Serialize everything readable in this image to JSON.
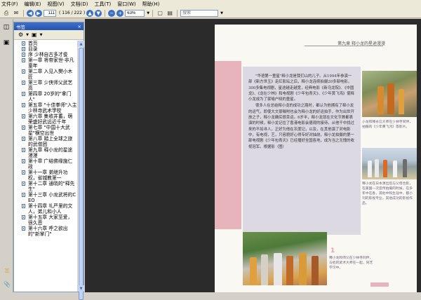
{
  "menubar": {
    "items": [
      "文件(F)",
      "编辑(E)",
      "视图(V)",
      "文档(D)",
      "工具(T)",
      "窗口(W)",
      "帮助(H)"
    ]
  },
  "toolbar": {
    "page_current": "111",
    "page_count": "( 116 / 222 )",
    "zoom": "63%",
    "search_placeholder": "搜索"
  },
  "bookmarks_panel": {
    "title": "书签",
    "close": "×",
    "items": [
      "首页",
      "目录",
      "序 少林自古多才俊",
      "第一章 将帝家世·非凡童年",
      "第二章 入见入樊小木匠",
      "第三章 少侠师父武艺高",
      "第四章 20岁的\"拿门人\"",
      "第五章 \"十佳拳师\"入主少林寺武术学校",
      "第六章 集收并蓄，萌荣盛好武远近千年",
      "第七章 \"中国十大武星\"横空出世",
      "第八章 踏上全球之旅的武僧团",
      "第九章 释小龙的星途漫漫",
      "第十章 广结佛缘施仁政",
      "第十一章 弟继升功权，省城教第一",
      "第十二章 通晓的\"释先生\"",
      "第十三章 小龙武将的CEO",
      "第十四章 礼严里的文人，弟儿和小人",
      "第十五章 大家至爱，很久恩",
      "第十六章 呼之欲出的\"新掌门\""
    ]
  },
  "page": {
    "chapter_header": "第九章  释小龙的星途漫漫",
    "paragraphs": [
      "\"华语第一童星\"释小龙是我们山的儿子。从1994年参演一部《新方世玉》走红影坛之后，释小龙连续拍摄20多部电影，300多集电视剧，星途越走越宽，经典电影《新乌龙院》、《中国龙》、《龙在少林》和电视剧《少年包青天》、《少年黄飞鸿》使释小龙成为了家喻户晓的童星。",
      "很多人在总结释小龙的成功之路时，都认为他拥有了释小龙的运气，即使大文豪嘱咐也会为释小龙的好运拍手，作为出世开放之子，释小龙确实很幸运。6岁半，释小龙就在文化节首都表演的时候，释小龙记住了香港电影会德观的接待，从他千中找过来的不如寻人，正好为他在灰度记，以及，在其他演了对电影中，有电视，艺，只容貌好心得专好对抽烧，释小龙拍摄的第一部电视剧《少年包青天》已经播好全国各地，成为当之无愧的收视冠军。根据影（图）"
    ],
    "captions": [
      "小龙和释永信大师在少林寺同伴，拍摄的《少年黄飞鸿》等影片。",
      "释小龙在日本演出后与父母合影，在美国一次宣传拍摄的时候，在多年中在各，其他中和生涯中，都小刊的影视专业，其他成功的影视作品。",
      "释小龙和师父在少林寺同伴，与他的武术大师在一起，同艺学习中。"
    ],
    "caption_number": "1"
  },
  "colors": {
    "accent_pink": "#e8b4bc",
    "text_block": "#dcd9e3",
    "viewer_bg": "#2b2b2b",
    "panel_header": "#2454b0"
  },
  "icons": [
    "print-icon",
    "email-icon",
    "back-icon",
    "forward-icon",
    "prev-page-icon",
    "next-page-icon",
    "zoom-out-icon",
    "zoom-in-icon",
    "save-icon",
    "fit-page-icon",
    "bookmark-icon",
    "pages-icon",
    "gear-icon",
    "attachment-icon"
  ]
}
